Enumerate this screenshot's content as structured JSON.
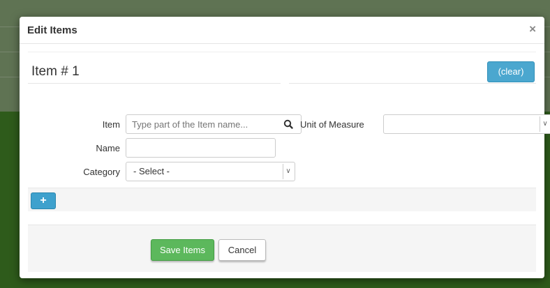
{
  "modal": {
    "title": "Edit Items",
    "close_label": "×"
  },
  "item_panel": {
    "heading": "Item # 1",
    "clear_label": "(clear)",
    "fields": {
      "item_label": "Item",
      "item_placeholder": "Type part of the Item name...",
      "item_value": "",
      "name_label": "Name",
      "name_value": "",
      "category_label": "Category",
      "category_selected": "- Select -",
      "uom_label": "Unit of Measure",
      "uom_selected": ""
    }
  },
  "actions": {
    "add_label": "+",
    "save_label": "Save Items",
    "cancel_label": "Cancel"
  },
  "colors": {
    "primary_blue": "#4ba7cf",
    "success_green": "#5cb85c",
    "background_green": "#4f8a2f"
  },
  "icons": {
    "search": "search-icon",
    "dropdown": "chevron-down-icon",
    "close": "close-icon",
    "add": "plus-icon"
  }
}
